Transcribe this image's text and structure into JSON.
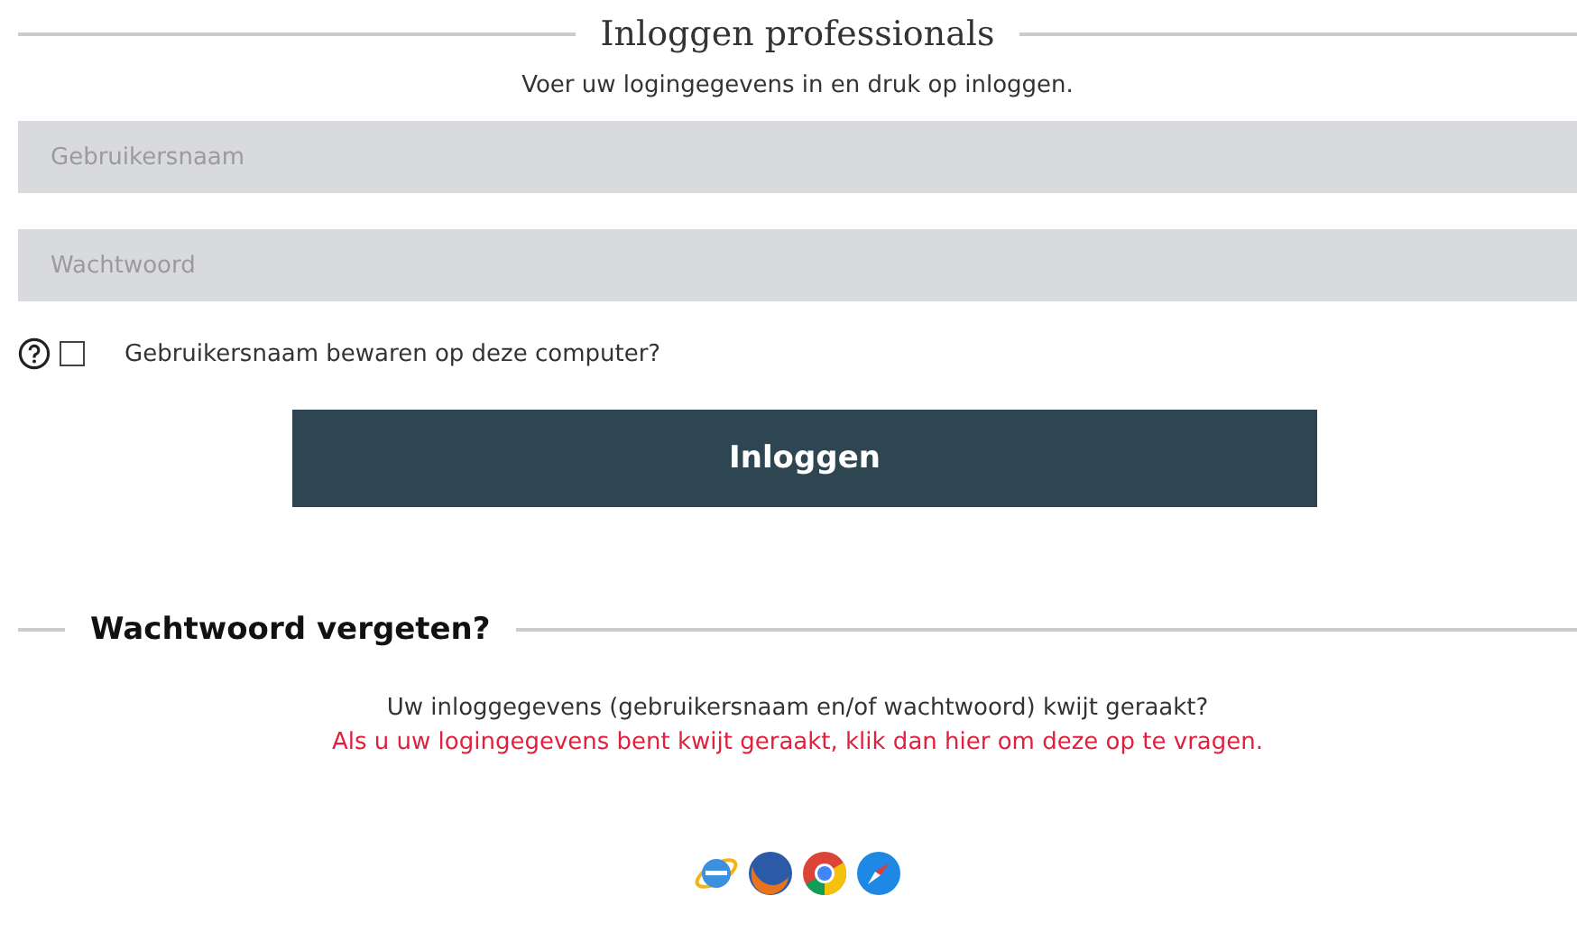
{
  "title": "Inloggen professionals",
  "subtitle": "Voer uw logingegevens in en druk op inloggen.",
  "fields": [
    {
      "placeholder": "Gebruikersnaam"
    },
    {
      "placeholder": "Wachtwoord"
    }
  ],
  "remember": {
    "label": "Gebruikersnaam bewaren op deze computer?",
    "checked": false
  },
  "login_button": "Inloggen",
  "forgot": {
    "heading": "Wachtwoord vergeten?",
    "question": "Uw inloggegevens (gebruikersnaam en/of wachtwoord) kwijt geraakt?",
    "link": "Als u uw logingegevens bent kwijt geraakt, klik dan hier om deze op te vragen."
  }
}
